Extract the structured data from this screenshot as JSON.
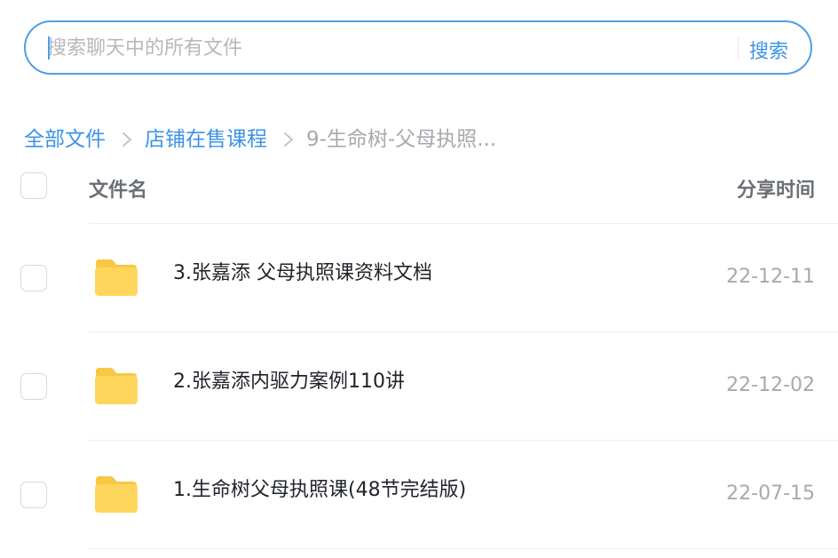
{
  "search": {
    "placeholder": "搜索聊天中的所有文件",
    "value": "",
    "button_label": "搜索"
  },
  "breadcrumb": {
    "items": [
      {
        "label": "全部文件"
      },
      {
        "label": "店铺在售课程"
      },
      {
        "label": "9-生命树-父母执照..."
      }
    ]
  },
  "table": {
    "columns": {
      "name": "文件名",
      "time": "分享时间"
    },
    "rows": [
      {
        "name": "3.张嘉添 父母执照课资料文档",
        "date": "22-12-11",
        "icon": "folder-icon",
        "selected": false
      },
      {
        "name": "2.张嘉添内驱力案例110讲",
        "date": "22-12-02",
        "icon": "folder-icon",
        "selected": false
      },
      {
        "name": "1.生命树父母执照课(48节完结版)",
        "date": "22-07-15",
        "icon": "folder-icon",
        "selected": false
      }
    ]
  },
  "colors": {
    "accent": "#3c93e6",
    "search_border": "#4d9fe8",
    "folder_body": "#ffd65c",
    "folder_tab": "#f7c844",
    "muted_text": "#a6a9ad"
  }
}
